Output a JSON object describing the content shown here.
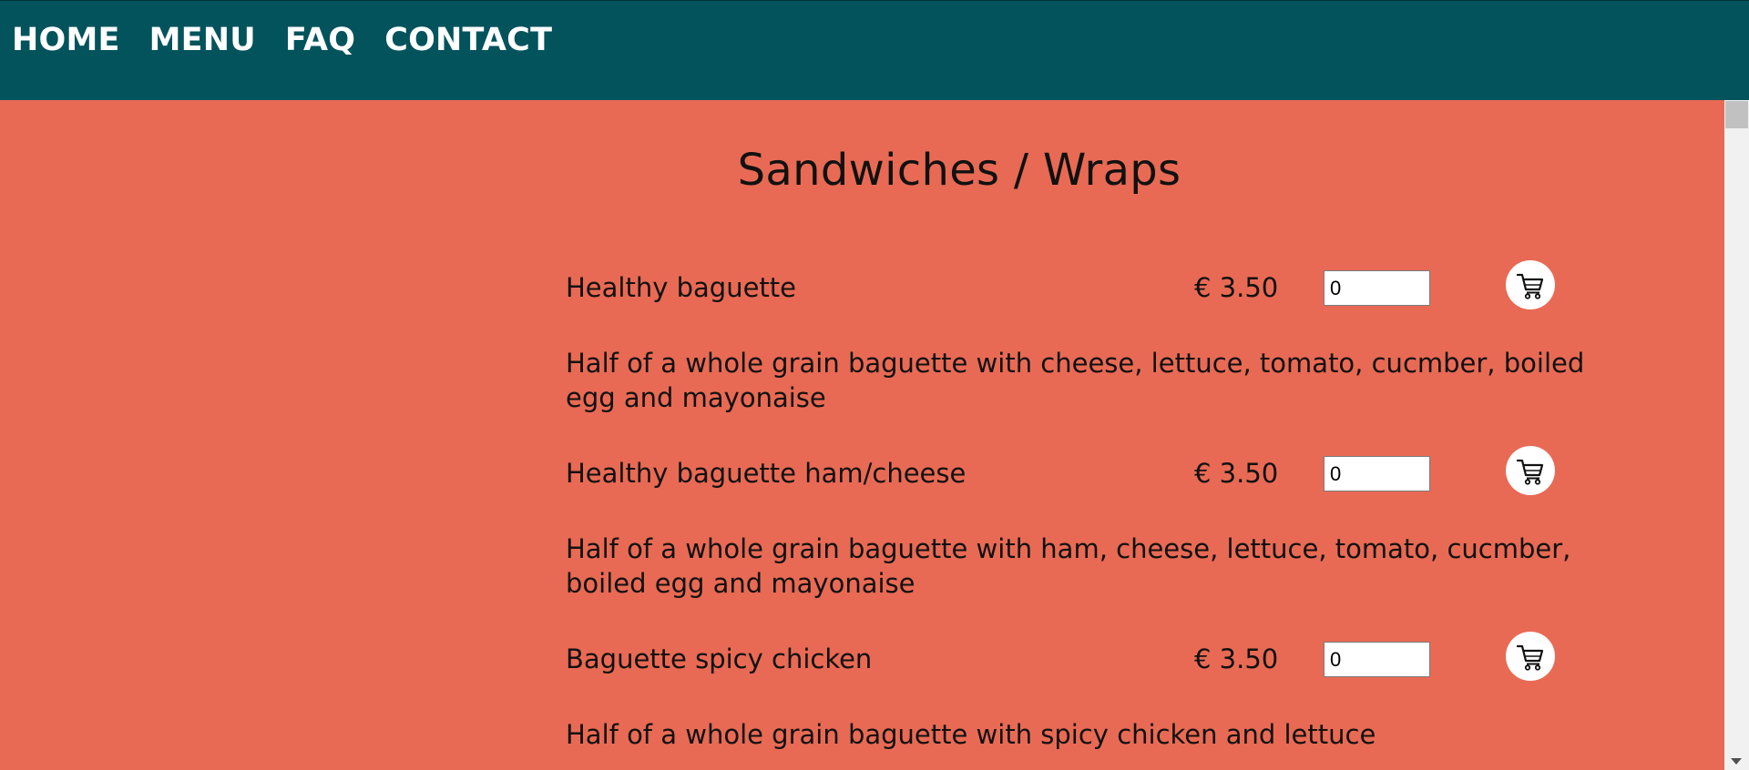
{
  "nav": {
    "links": [
      "HOME",
      "MENU",
      "FAQ",
      "CONTACT"
    ]
  },
  "section": {
    "title": "Sandwiches / Wraps"
  },
  "items": [
    {
      "name": "Healthy baguette",
      "price": "€ 3.50",
      "quantity": "0",
      "description": "Half of a whole grain baguette with cheese, lettuce, tomato, cucmber, boiled egg and mayonaise"
    },
    {
      "name": "Healthy baguette ham/cheese",
      "price": "€ 3.50",
      "quantity": "0",
      "description": "Half of a whole grain baguette with ham, cheese, lettuce, tomato, cucmber, boiled egg and mayonaise"
    },
    {
      "name": "Baguette spicy chicken",
      "price": "€ 3.50",
      "quantity": "0",
      "description": "Half of a whole grain baguette with spicy chicken and lettuce"
    }
  ],
  "icons": {
    "cart": "shopping-cart-icon"
  },
  "colors": {
    "nav_background": "#02535c",
    "page_background": "#e86a54",
    "nav_text": "#ffffff"
  }
}
